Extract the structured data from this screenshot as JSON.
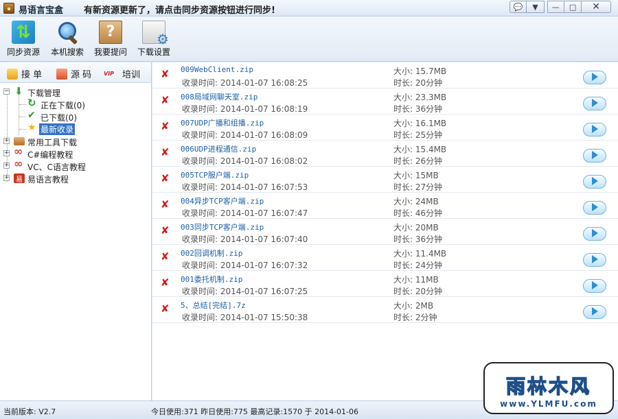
{
  "window": {
    "title": "易语言宝盒",
    "notice": "有新资源更新了，请点击同步资源按钮进行同步!",
    "controls": [
      "chat-icon",
      "menu-arrow-icon",
      "minimize-icon",
      "maximize-icon",
      "close-icon"
    ]
  },
  "toolbar": {
    "sync": "同步资源",
    "local_search": "本机搜索",
    "ask": "我要提问",
    "download_settings": "下载设置"
  },
  "side_tabs": {
    "connect": "接 单",
    "source": "源 码",
    "vip": "VIP",
    "training": "培训"
  },
  "tree": {
    "download_mgmt": "下载管理",
    "downloading": "正在下载(0)",
    "downloaded": "已下载(0)",
    "newest": "最新收录",
    "tools": "常用工具下载",
    "csharp": "C#编程教程",
    "vc": "VC、C语言教程",
    "eyuyan": "易语言教程"
  },
  "list": {
    "items": [
      {
        "name": "009WebClient.zip",
        "time": "收录时间: 2014-01-07 16:08:25",
        "size": "大小: 15.7MB",
        "duration": "时长: 20分钟"
      },
      {
        "name": "008局域网聊天室.zip",
        "time": "收录时间: 2014-01-07 16:08:19",
        "size": "大小: 23.3MB",
        "duration": "时长: 36分钟"
      },
      {
        "name": "007UDP广播和组播.zip",
        "time": "收录时间: 2014-01-07 16:08:09",
        "size": "大小: 16.1MB",
        "duration": "时长: 25分钟"
      },
      {
        "name": "006UDP进程通信.zip",
        "time": "收录时间: 2014-01-07 16:08:02",
        "size": "大小: 15.4MB",
        "duration": "时长: 26分钟"
      },
      {
        "name": "005TCP服户端.zip",
        "time": "收录时间: 2014-01-07 16:07:53",
        "size": "大小: 15MB",
        "duration": "时长: 27分钟"
      },
      {
        "name": "004异步TCP客户端.zip",
        "time": "收录时间: 2014-01-07 16:07:47",
        "size": "大小: 24MB",
        "duration": "时长: 46分钟"
      },
      {
        "name": "003同步TCP客户端.zip",
        "time": "收录时间: 2014-01-07 16:07:40",
        "size": "大小: 20MB",
        "duration": "时长: 36分钟"
      },
      {
        "name": "002回调机制.zip",
        "time": "收录时间: 2014-01-07 16:07:32",
        "size": "大小: 11.4MB",
        "duration": "时长: 24分钟"
      },
      {
        "name": "001委托机制.zip",
        "time": "收录时间: 2014-01-07 16:07:25",
        "size": "大小: 11MB",
        "duration": "时长: 20分钟"
      },
      {
        "name": "5、总结[完结].7z",
        "time": "收录时间: 2014-01-07 15:50:38",
        "size": "大小: 2MB",
        "duration": "时长: 2分钟"
      }
    ]
  },
  "status": {
    "version": "当前版本: V2.7",
    "stats": "今日使用:371  昨日使用:775  最高记录:1570 于 2014-01-06"
  },
  "watermark": {
    "main": "雨林木风",
    "url": "www.YLMFU.com"
  },
  "colors": {
    "selection": "#3372c6",
    "link": "#1a5fa8",
    "delete": "#d21c1c"
  }
}
